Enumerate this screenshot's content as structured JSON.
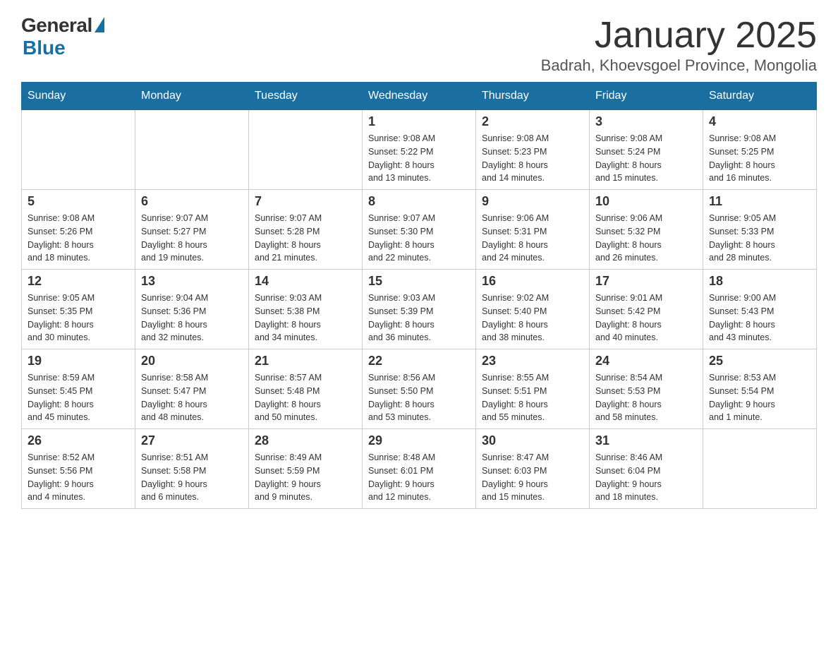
{
  "header": {
    "logo_general": "General",
    "logo_blue": "Blue",
    "month_title": "January 2025",
    "location": "Badrah, Khoevsgoel Province, Mongolia"
  },
  "weekdays": [
    "Sunday",
    "Monday",
    "Tuesday",
    "Wednesday",
    "Thursday",
    "Friday",
    "Saturday"
  ],
  "weeks": [
    [
      {
        "day": "",
        "info": ""
      },
      {
        "day": "",
        "info": ""
      },
      {
        "day": "",
        "info": ""
      },
      {
        "day": "1",
        "info": "Sunrise: 9:08 AM\nSunset: 5:22 PM\nDaylight: 8 hours\nand 13 minutes."
      },
      {
        "day": "2",
        "info": "Sunrise: 9:08 AM\nSunset: 5:23 PM\nDaylight: 8 hours\nand 14 minutes."
      },
      {
        "day": "3",
        "info": "Sunrise: 9:08 AM\nSunset: 5:24 PM\nDaylight: 8 hours\nand 15 minutes."
      },
      {
        "day": "4",
        "info": "Sunrise: 9:08 AM\nSunset: 5:25 PM\nDaylight: 8 hours\nand 16 minutes."
      }
    ],
    [
      {
        "day": "5",
        "info": "Sunrise: 9:08 AM\nSunset: 5:26 PM\nDaylight: 8 hours\nand 18 minutes."
      },
      {
        "day": "6",
        "info": "Sunrise: 9:07 AM\nSunset: 5:27 PM\nDaylight: 8 hours\nand 19 minutes."
      },
      {
        "day": "7",
        "info": "Sunrise: 9:07 AM\nSunset: 5:28 PM\nDaylight: 8 hours\nand 21 minutes."
      },
      {
        "day": "8",
        "info": "Sunrise: 9:07 AM\nSunset: 5:30 PM\nDaylight: 8 hours\nand 22 minutes."
      },
      {
        "day": "9",
        "info": "Sunrise: 9:06 AM\nSunset: 5:31 PM\nDaylight: 8 hours\nand 24 minutes."
      },
      {
        "day": "10",
        "info": "Sunrise: 9:06 AM\nSunset: 5:32 PM\nDaylight: 8 hours\nand 26 minutes."
      },
      {
        "day": "11",
        "info": "Sunrise: 9:05 AM\nSunset: 5:33 PM\nDaylight: 8 hours\nand 28 minutes."
      }
    ],
    [
      {
        "day": "12",
        "info": "Sunrise: 9:05 AM\nSunset: 5:35 PM\nDaylight: 8 hours\nand 30 minutes."
      },
      {
        "day": "13",
        "info": "Sunrise: 9:04 AM\nSunset: 5:36 PM\nDaylight: 8 hours\nand 32 minutes."
      },
      {
        "day": "14",
        "info": "Sunrise: 9:03 AM\nSunset: 5:38 PM\nDaylight: 8 hours\nand 34 minutes."
      },
      {
        "day": "15",
        "info": "Sunrise: 9:03 AM\nSunset: 5:39 PM\nDaylight: 8 hours\nand 36 minutes."
      },
      {
        "day": "16",
        "info": "Sunrise: 9:02 AM\nSunset: 5:40 PM\nDaylight: 8 hours\nand 38 minutes."
      },
      {
        "day": "17",
        "info": "Sunrise: 9:01 AM\nSunset: 5:42 PM\nDaylight: 8 hours\nand 40 minutes."
      },
      {
        "day": "18",
        "info": "Sunrise: 9:00 AM\nSunset: 5:43 PM\nDaylight: 8 hours\nand 43 minutes."
      }
    ],
    [
      {
        "day": "19",
        "info": "Sunrise: 8:59 AM\nSunset: 5:45 PM\nDaylight: 8 hours\nand 45 minutes."
      },
      {
        "day": "20",
        "info": "Sunrise: 8:58 AM\nSunset: 5:47 PM\nDaylight: 8 hours\nand 48 minutes."
      },
      {
        "day": "21",
        "info": "Sunrise: 8:57 AM\nSunset: 5:48 PM\nDaylight: 8 hours\nand 50 minutes."
      },
      {
        "day": "22",
        "info": "Sunrise: 8:56 AM\nSunset: 5:50 PM\nDaylight: 8 hours\nand 53 minutes."
      },
      {
        "day": "23",
        "info": "Sunrise: 8:55 AM\nSunset: 5:51 PM\nDaylight: 8 hours\nand 55 minutes."
      },
      {
        "day": "24",
        "info": "Sunrise: 8:54 AM\nSunset: 5:53 PM\nDaylight: 8 hours\nand 58 minutes."
      },
      {
        "day": "25",
        "info": "Sunrise: 8:53 AM\nSunset: 5:54 PM\nDaylight: 9 hours\nand 1 minute."
      }
    ],
    [
      {
        "day": "26",
        "info": "Sunrise: 8:52 AM\nSunset: 5:56 PM\nDaylight: 9 hours\nand 4 minutes."
      },
      {
        "day": "27",
        "info": "Sunrise: 8:51 AM\nSunset: 5:58 PM\nDaylight: 9 hours\nand 6 minutes."
      },
      {
        "day": "28",
        "info": "Sunrise: 8:49 AM\nSunset: 5:59 PM\nDaylight: 9 hours\nand 9 minutes."
      },
      {
        "day": "29",
        "info": "Sunrise: 8:48 AM\nSunset: 6:01 PM\nDaylight: 9 hours\nand 12 minutes."
      },
      {
        "day": "30",
        "info": "Sunrise: 8:47 AM\nSunset: 6:03 PM\nDaylight: 9 hours\nand 15 minutes."
      },
      {
        "day": "31",
        "info": "Sunrise: 8:46 AM\nSunset: 6:04 PM\nDaylight: 9 hours\nand 18 minutes."
      },
      {
        "day": "",
        "info": ""
      }
    ]
  ]
}
